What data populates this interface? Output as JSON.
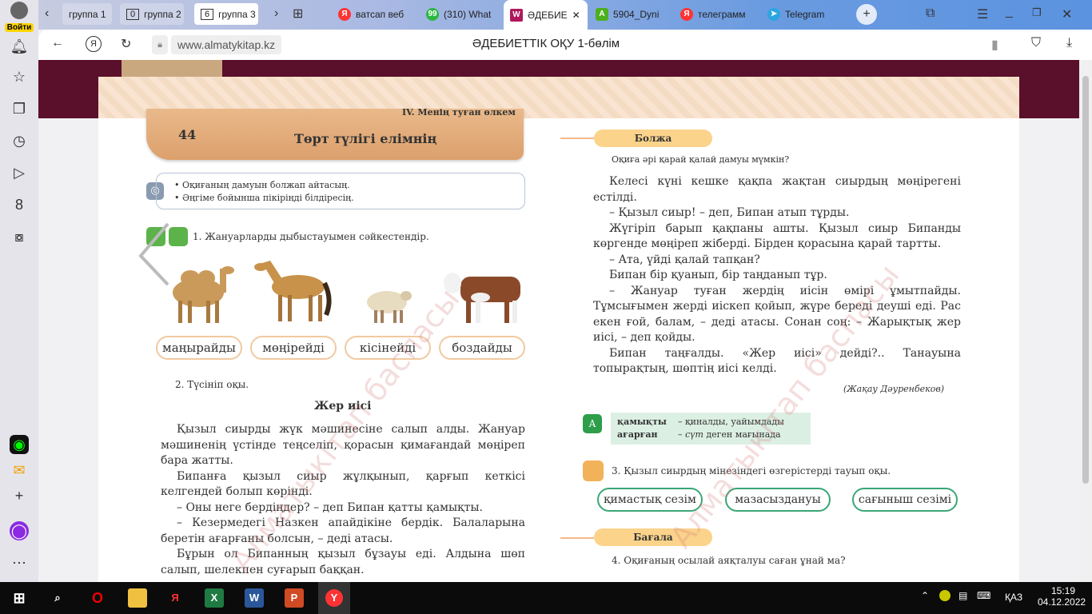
{
  "browser": {
    "login_label": "Войти",
    "tab_groups": [
      {
        "count": "",
        "label": "группа 1"
      },
      {
        "count": "0",
        "label": "группа 2"
      },
      {
        "count": "6",
        "label": "группа 3"
      }
    ],
    "tabs": [
      {
        "label": "ватсап веб",
        "icon": "yandex-icon",
        "color": "#f33"
      },
      {
        "label": "(310) What",
        "icon": "whatsapp-icon",
        "color": "#2cb742"
      },
      {
        "label": "ӘДЕБИЕ",
        "icon": "book-icon",
        "color": "#b0185a",
        "active": true
      },
      {
        "label": "5904_Dyni",
        "icon": "a-icon",
        "color": "#4caf1e"
      },
      {
        "label": "телеграмм",
        "icon": "yandex-icon",
        "color": "#f33"
      },
      {
        "label": "Telegram",
        "icon": "telegram-icon",
        "color": "#2ca5e0"
      }
    ],
    "url": "www.almatykitap.kz",
    "page_title": "ӘДЕБИЕТТІК ОҚУ 1-бөлім"
  },
  "book": {
    "chapter": "IV. Менің туған өлкем",
    "lesson_number": "44",
    "lesson_title": "Төрт түлігі елімнің",
    "goals": [
      "• Оқиғаның дамуын болжап айтасың.",
      "• Әңгіме бойынша пікіріңді білдіресің."
    ],
    "task1": "1. Жануарларды дыбыстауымен сәйкестендір.",
    "sounds": [
      "маңырайды",
      "мөңірейді",
      "кісінейді",
      "боздайды"
    ],
    "task2": "2. Түсініп оқы.",
    "story_title": "Жер иісі",
    "left_paragraphs": [
      "Қызыл сиырды жүк мәшинесіне салып алды. Жануар мәшиненің үстінде теңселіп, қорасын қимағандай мөңіреп бара жатты.",
      "Бипанға қызыл сиыр жұлқынып, қарғып кеткісі келгендей болып көрінді.",
      "– Оны неге бердіңдер? – деп Бипан қатты қамықты.",
      "– Кезермедегі Назкен апайдікіне бердік. Балаларына беретін ағарғаны болсын, – деді атасы.",
      "Бұрын ол Бипанның қызыл бұзауы еді. Алдына шөп салып, шелекпен суғарып баққан."
    ],
    "predict_label": "Болжа",
    "predict_q": "Оқиға әрі қарай қалай дамуы мүмкін?",
    "right_paragraphs": [
      "Келесі күні кешке қақпа жақтан сиырдың мөңірегені естілді.",
      "– Қызыл сиыр! – деп, Бипан атып тұрды.",
      "Жүгіріп барып қақпаны ашты. Қызыл сиыр Бипанды көргенде мөңіреп жіберді. Бірден қорасына қарай тартты.",
      "– Ата, үйді қалай тапқан?",
      "Бипан бір қуанып, бір таңданып тұр.",
      "– Жануар туған жердің иісін өмірі ұмытпайды. Тұмсығымен жерді иіскеп қойып, жүре береді деуші еді. Рас екен ғой, балам, – деді атасы. Сонан соң: – Жарықтық жер иісі, – деп қойды.",
      "Бипан таңғалды. «Жер иісі» дейді?.. Танауына топырақтың, шөптің иісі келді."
    ],
    "author": "(Жақау Дәуренбеков)",
    "glossary": [
      {
        "word": "қамықты",
        "def": "– қиналды, уайымдады"
      },
      {
        "word": "ағарған",
        "def_em": "сүт",
        "def": "деген мағынада"
      }
    ],
    "task3": "3. Қызыл сиырдың мінезіндегі өзгерістерді тауып оқы.",
    "traits": [
      "қимастық сезім",
      "мазасыздануы",
      "сағыныш сезімі"
    ],
    "evaluate_label": "Бағала",
    "task4": "4. Оқиғаның осылай аяқталуы саған ұнай ма?",
    "watermark": "Алматыкітап баспасы"
  },
  "taskbar": {
    "lang": "ҚАЗ",
    "time": "15:19",
    "date": "04.12.2022"
  }
}
